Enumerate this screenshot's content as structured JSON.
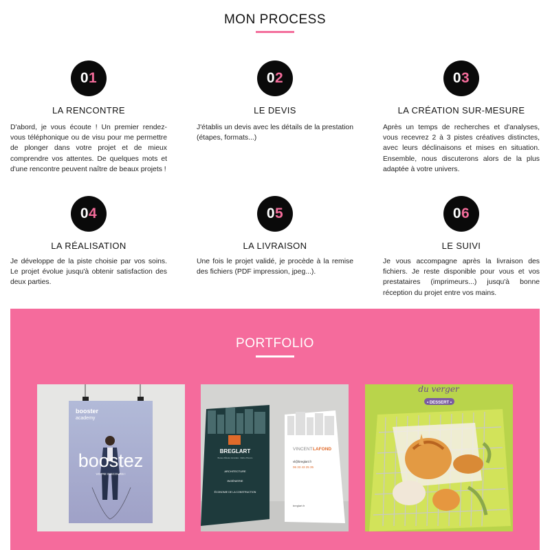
{
  "process": {
    "title": "MON PROCESS",
    "steps": [
      {
        "num_a": "0",
        "num_b": "1",
        "title": "LA RENCONTRE",
        "text": "D'abord, je vous écoute ! Un premier rendez-vous téléphonique ou de visu pour me permettre de plonger dans votre projet et de mieux comprendre vos attentes. De quelques mots et d'une rencontre peuvent naître de beaux projets !"
      },
      {
        "num_a": "0",
        "num_b": "2",
        "title": "LE DEVIS",
        "text": "J'établis un devis avec les détails de la prestation (étapes, formats...)"
      },
      {
        "num_a": "0",
        "num_b": "3",
        "title": "LA CRÉATION SUR-MESURE",
        "text": "Après un temps de recherches et d'analyses, vous recevrez 2 à 3 pistes créatives distinctes, avec leurs déclinaisons et mises en situation. Ensemble, nous discuterons alors de la plus adaptée à votre univers."
      },
      {
        "num_a": "0",
        "num_b": "4",
        "title": "LA RÉALISATION",
        "text": "Je développe de la piste choisie par vos soins. Le projet évolue jusqu'à obtenir satisfaction des deux parties."
      },
      {
        "num_a": "0",
        "num_b": "5",
        "title": "LA LIVRAISON",
        "text": "Une fois le projet validé, je procède à la remise des fichiers (PDF impression, jpeg...)."
      },
      {
        "num_a": "0",
        "num_b": "6",
        "title": "LE SUIVI",
        "text": "Je vous accompagne après la livraison des fichiers. Je reste disponible pour vous et vos prestataires (imprimeurs...) jusqu'à bonne réception du projet entre vos mains."
      }
    ]
  },
  "portfolio": {
    "title": "PORTFOLIO",
    "items": [
      {
        "kind": "poster",
        "brand_line1": "booster",
        "brand_line2": "academy",
        "headline": "boostez",
        "tagline": "VOTRE DISCOURS !"
      },
      {
        "kind": "business-cards",
        "brand": "BREGLART",
        "subtitle": "Bureau d'Études Générales · Maître d'Oeuvre",
        "services": [
          "ARCHITECTURE",
          "INGÉNIERIE",
          "ÉCONOMIE DE LA CONSTRUCTION"
        ],
        "person_first": "VINCENT",
        "person_last": "LAFOND",
        "email": "vl@breglart.fr",
        "phone": "06 33 43 25 35",
        "website": "breglart.fr"
      },
      {
        "kind": "food",
        "script_title": "du verger",
        "tag": "• DESSERT •"
      }
    ]
  },
  "colors": {
    "accent_pink": "#f36c9a",
    "portfolio_bg": "#f56b9c",
    "badge_bg": "#0a0a0a"
  }
}
